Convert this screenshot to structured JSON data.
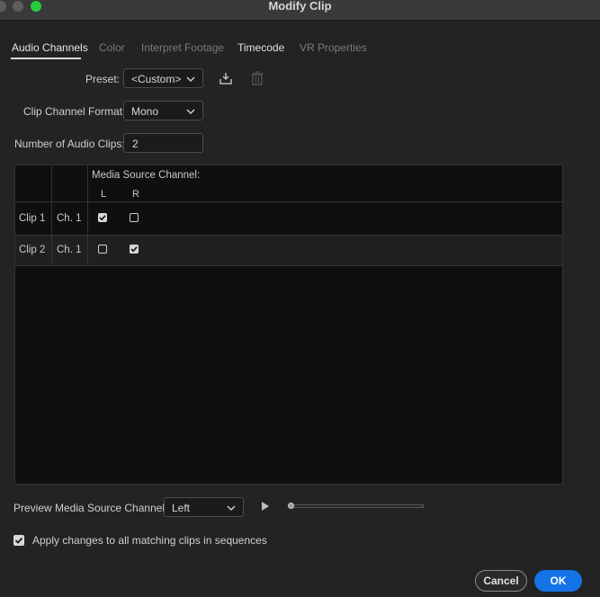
{
  "window": {
    "title": "Modify Clip"
  },
  "tabs": [
    {
      "label": "Audio Channels",
      "state": "active"
    },
    {
      "label": "Color",
      "state": "disabled"
    },
    {
      "label": "Interpret Footage",
      "state": "disabled"
    },
    {
      "label": "Timecode",
      "state": "enabled"
    },
    {
      "label": "VR Properties",
      "state": "disabled"
    }
  ],
  "form": {
    "preset_label": "Preset:",
    "preset_value": "<Custom>",
    "format_label": "Clip Channel Format:",
    "format_value": "Mono",
    "num_clips_label": "Number of Audio Clips:",
    "num_clips_value": "2"
  },
  "table": {
    "header": "Media Source Channel:",
    "channels": [
      "L",
      "R"
    ],
    "rows": [
      {
        "clip": "Clip 1",
        "channel": "Ch. 1",
        "L": true,
        "R": false
      },
      {
        "clip": "Clip 2",
        "channel": "Ch. 1",
        "L": false,
        "R": true
      }
    ]
  },
  "preview": {
    "label": "Preview Media Source Channel:",
    "value": "Left",
    "progress": 0
  },
  "apply": {
    "label": "Apply changes to all matching clips in sequences",
    "checked": true
  },
  "buttons": {
    "cancel": "Cancel",
    "ok": "OK"
  },
  "colors": {
    "accent": "#1473e6",
    "background": "#232323",
    "panel": "#0f0f0f"
  },
  "icons": [
    "save-preset-icon",
    "delete-preset-icon",
    "play-icon",
    "chevron-down-icon",
    "checkmark-icon"
  ]
}
